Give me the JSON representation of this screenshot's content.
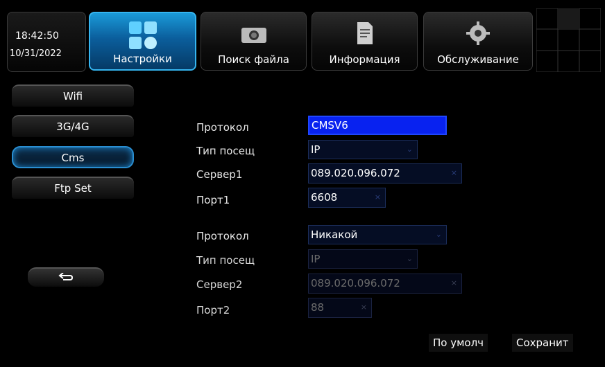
{
  "clock": {
    "time": "18:42:50",
    "date": "10/31/2022"
  },
  "tabs": [
    {
      "label": "Настройки",
      "icon": "settings-grid-icon"
    },
    {
      "label": "Поиск файла",
      "icon": "camera-search-icon"
    },
    {
      "label": "Информация",
      "icon": "document-icon"
    },
    {
      "label": "Обслуживание",
      "icon": "gear-icon"
    }
  ],
  "sidebar": {
    "items": [
      {
        "label": "Wifi"
      },
      {
        "label": "3G/4G"
      },
      {
        "label": "Cms"
      },
      {
        "label": "Ftp Set"
      }
    ],
    "back_icon": "back-arrow-icon"
  },
  "form": {
    "group1": {
      "protocol_label": "Протокол",
      "protocol_value": "CMSV6",
      "access_label": "Тип посещ",
      "access_value": "IP",
      "server_label": "Сервер1",
      "server_value": "089.020.096.072",
      "port_label": "Порт1",
      "port_value": "6608"
    },
    "group2": {
      "protocol_label": "Протокол",
      "protocol_value": "Никакой",
      "access_label": "Тип посещ",
      "access_value": "IP",
      "server_label": "Сервер2",
      "server_value": "089.020.096.072",
      "port_label": "Порт2",
      "port_value": "88"
    }
  },
  "buttons": {
    "default": "По умолч",
    "save": "Сохранит"
  },
  "colors": {
    "accent": "#1a9ad8",
    "selected_field": "#0822f0"
  }
}
